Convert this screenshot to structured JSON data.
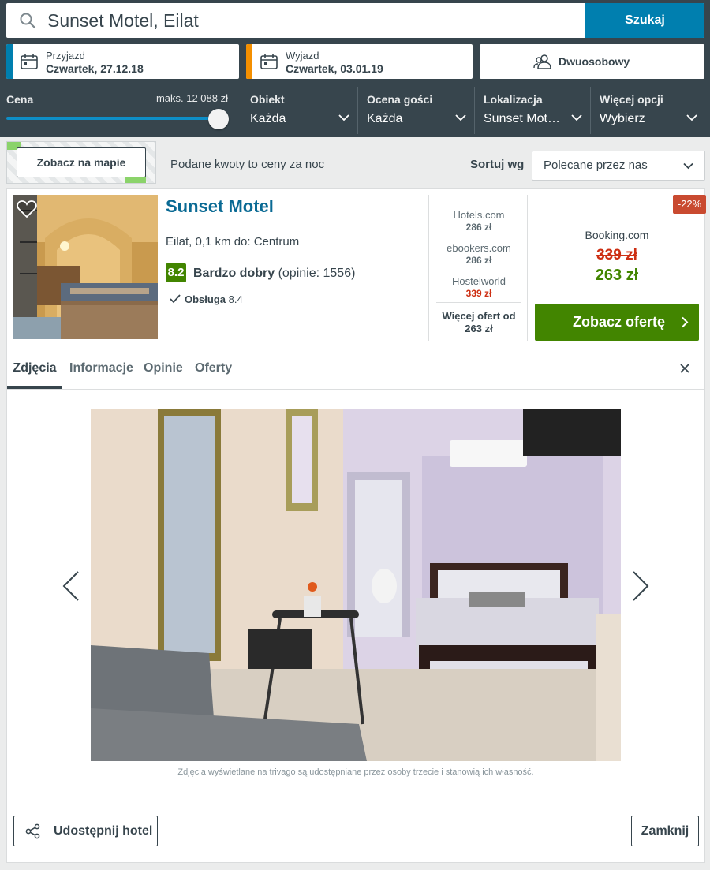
{
  "search": {
    "query": "Sunset Motel, Eilat",
    "button": "Szukaj"
  },
  "dates": {
    "checkin_label": "Przyjazd",
    "checkin_value": "Czwartek, 27.12.18",
    "checkout_label": "Wyjazd",
    "checkout_value": "Czwartek, 03.01.19"
  },
  "room": {
    "label": "Dwuosobowy"
  },
  "filters": {
    "price_label": "Cena",
    "price_max": "maks. 12 088 zł",
    "price_slider_fraction": 1.0,
    "property_label": "Obiekt",
    "property_value": "Każda",
    "rating_label": "Ocena gości",
    "rating_value": "Każda",
    "location_label": "Lokalizacja",
    "location_value": "Sunset Motel, Eilat",
    "more_label": "Więcej opcji",
    "more_value": "Wybierz"
  },
  "toolbar": {
    "map_button": "Zobacz na mapie",
    "prices_note": "Podane kwoty to ceny za noc",
    "sort_label": "Sortuj wg",
    "sort_value": "Polecane przez nas"
  },
  "hotel": {
    "name": "Sunset Motel",
    "location": "Eilat, 0,1 km do: Centrum",
    "rating_score": "8.2",
    "rating_text": "Bardzo dobry",
    "rating_reviews": "(opinie: 1556)",
    "service_label": "Obsługa",
    "service_score": "8.4",
    "offers": [
      {
        "provider": "Hotels.com",
        "price": "286 zł"
      },
      {
        "provider": "ebookers.com",
        "price": "286 zł"
      },
      {
        "provider": "Hostelworld",
        "price": "339 zł"
      }
    ],
    "more_offers_line1": "Więcej ofert od",
    "more_offers_line2": "263 zł",
    "discount": "-22%",
    "best_provider": "Booking.com",
    "old_price": "339 zł",
    "new_price": "263 zł",
    "deal_button": "Zobacz ofertę"
  },
  "tabs": [
    "Zdjęcia",
    "Informacje",
    "Opinie",
    "Oferty"
  ],
  "gallery": {
    "caption": "Zdjęcia wyświetlane na trivago są udostępniane przez osoby trzecie i stanowią ich własność."
  },
  "footer": {
    "share_button": "Udostępnij hotel",
    "close_button": "Zamknij"
  },
  "colors": {
    "header_bg": "#37454d",
    "search_button": "#007faf",
    "checkin_accent": "#007faf",
    "checkout_accent": "#f48f00",
    "rating_green": "#428500",
    "price_red": "#cd2f13",
    "discount_badge": "#c94a30"
  }
}
